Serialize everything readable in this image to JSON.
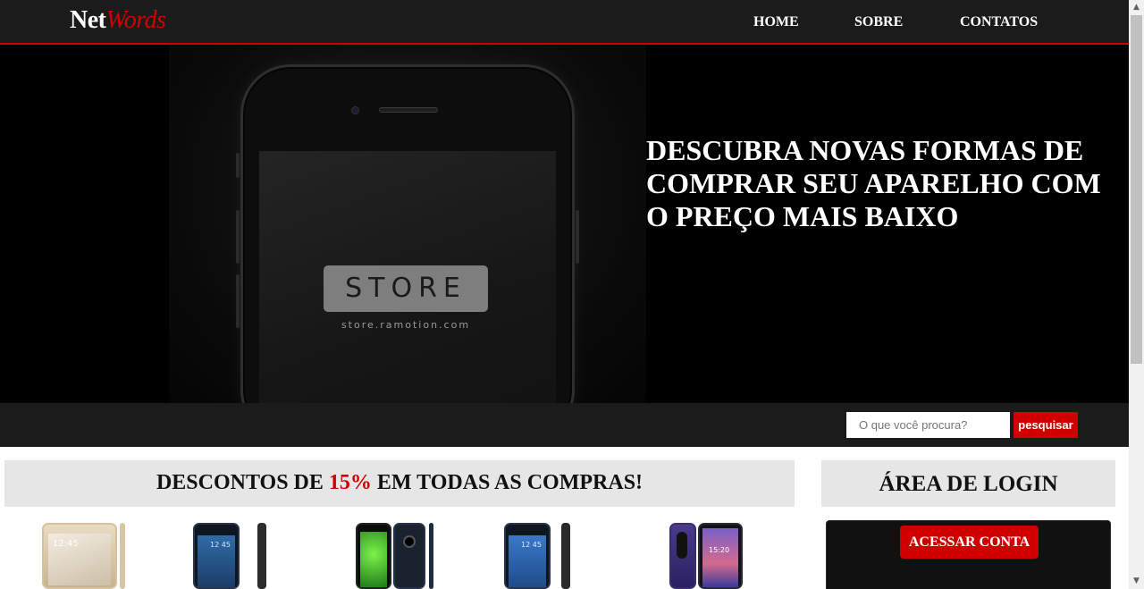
{
  "brand": {
    "logo_main": "Net",
    "logo_accent": "Words"
  },
  "nav": {
    "items": [
      {
        "label": "HOME"
      },
      {
        "label": "SOBRE"
      },
      {
        "label": "CONTATOS"
      }
    ]
  },
  "hero": {
    "headline": "DESCUBRA NOVAS FORMAS DE COMPRAR SEU APARELHO COM O PREÇO MAIS BAIXO",
    "badge_text": "STORE",
    "badge_url": "store.ramotion.com"
  },
  "search": {
    "placeholder": "O que você procura?",
    "button_label": "pesquisar"
  },
  "promo": {
    "text_before": "DESCONTOS DE ",
    "highlight": "15%",
    "text_after": " EM TODAS AS COMPRAS!"
  },
  "products": [
    {
      "icon": "phone-gold-icon",
      "screen_time": "12:45"
    },
    {
      "icon": "phone-blue-icon",
      "screen_time": "12 45"
    },
    {
      "icon": "phone-green-icon",
      "screen_time": ""
    },
    {
      "icon": "phone-black-icon",
      "screen_time": "12 45"
    },
    {
      "icon": "phone-purple-icon",
      "screen_time": "15:20"
    }
  ],
  "login": {
    "heading": "ÁREA DE LOGIN",
    "button_label": "ACESSAR CONTA"
  },
  "colors": {
    "accent": "#d00000",
    "nav_bg": "#1b1b1b",
    "hero_bg": "#000000",
    "panel_bg": "#e6e6e6"
  }
}
